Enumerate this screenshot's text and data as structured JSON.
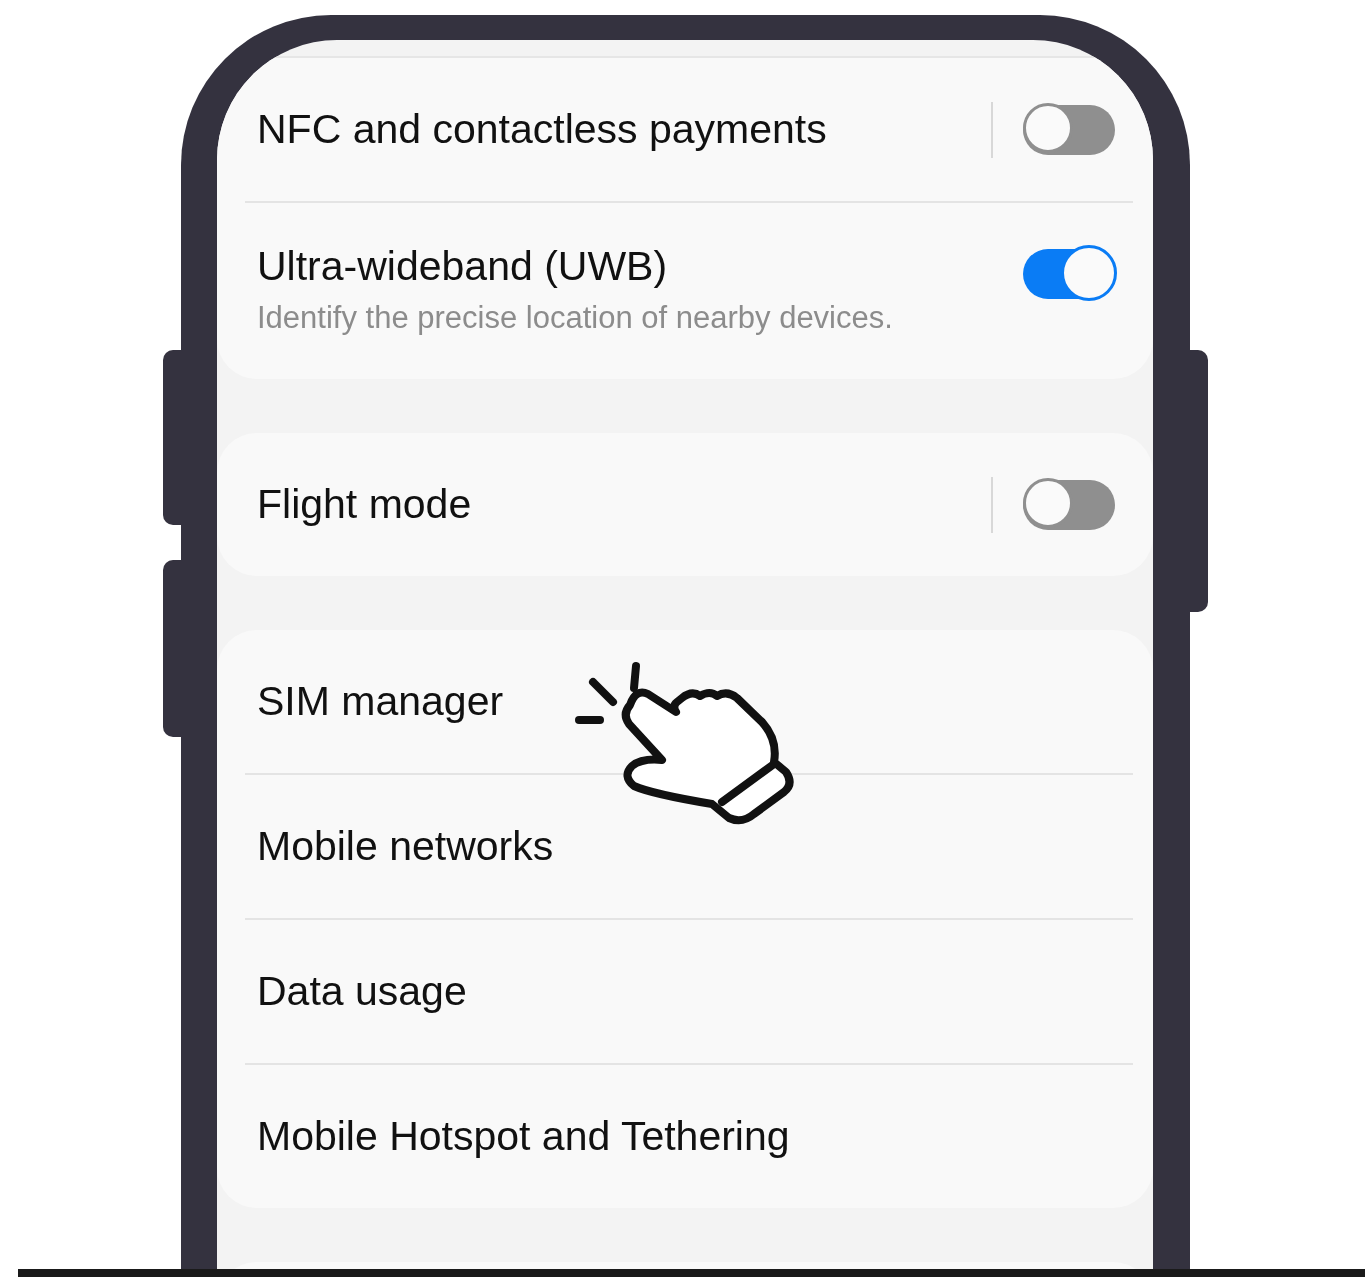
{
  "sections": [
    {
      "items": [
        {
          "title": "NFC and contactless payments",
          "kind": "switch",
          "on": false,
          "divider": true
        },
        {
          "title": "Ultra-wideband (UWB)",
          "subtitle": "Identify the precise location of nearby devices.",
          "kind": "switch",
          "on": true,
          "divider": false
        }
      ]
    },
    {
      "items": [
        {
          "title": "Flight mode",
          "kind": "switch",
          "on": false,
          "divider": true
        }
      ]
    },
    {
      "items": [
        {
          "title": "SIM manager",
          "kind": "link"
        },
        {
          "title": "Mobile networks",
          "kind": "link"
        },
        {
          "title": "Data usage",
          "kind": "link"
        },
        {
          "title": "Mobile Hotspot and Tethering",
          "kind": "link"
        }
      ]
    }
  ]
}
